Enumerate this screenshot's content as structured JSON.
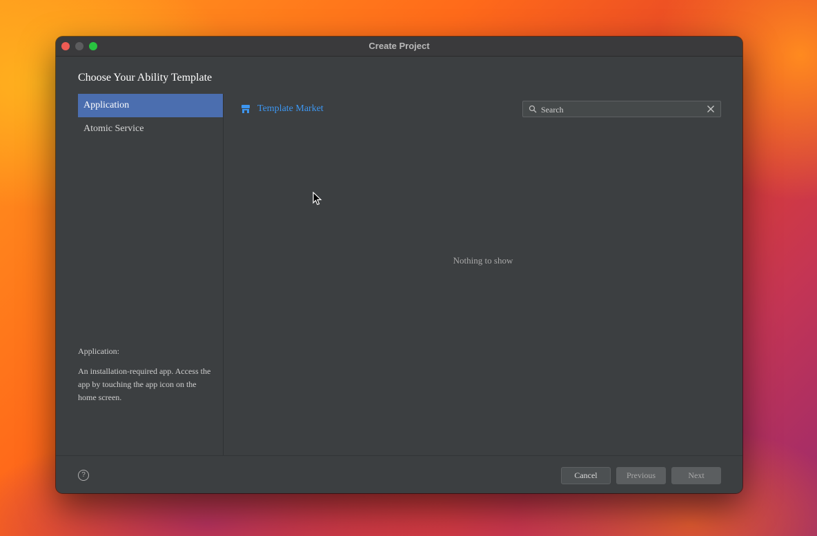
{
  "window": {
    "title": "Create Project"
  },
  "page": {
    "heading": "Choose Your Ability Template"
  },
  "sidebar": {
    "items": [
      {
        "label": "Application",
        "selected": true
      },
      {
        "label": "Atomic Service",
        "selected": false
      }
    ],
    "description": {
      "title": "Application:",
      "body": "An installation-required app. Access the app by touching the app icon on the home screen."
    }
  },
  "main": {
    "template_market": {
      "label": "Template Market",
      "icon": "store-icon"
    },
    "search": {
      "placeholder": "Search",
      "value": ""
    },
    "empty_message": "Nothing to show"
  },
  "footer": {
    "cancel_label": "Cancel",
    "previous_label": "Previous",
    "next_label": "Next",
    "help_icon": "help-icon"
  },
  "colors": {
    "accent": "#4b6eaf",
    "link": "#3d96f0",
    "window_bg": "#3c3f41"
  }
}
